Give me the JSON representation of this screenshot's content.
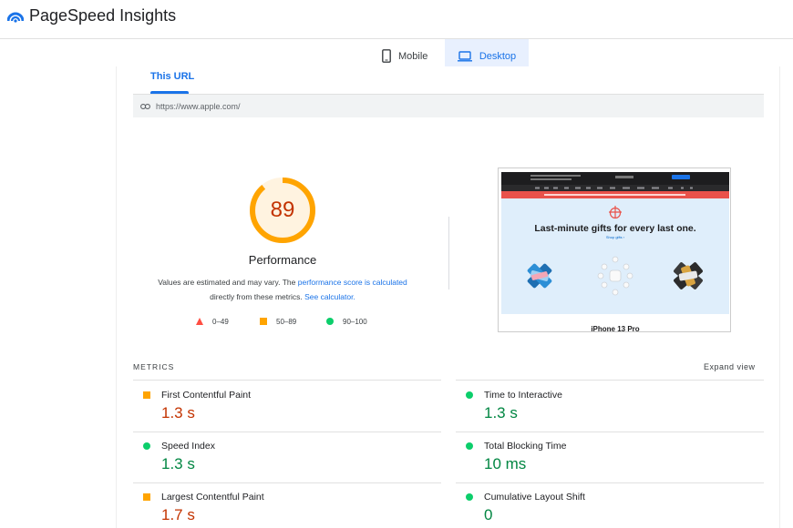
{
  "app": {
    "title": "PageSpeed Insights"
  },
  "devices": {
    "mobile": "Mobile",
    "desktop": "Desktop",
    "active": "desktop"
  },
  "url_tab": {
    "label": "This URL"
  },
  "url": "https://www.apple.com/",
  "score": {
    "value": "89",
    "value_fraction": 0.89,
    "label": "Performance",
    "note_prefix": "Values are estimated and may vary. The ",
    "note_link1": "performance score is calculated",
    "note_middle": "directly from these metrics. ",
    "note_link2": "See calculator.",
    "color": "#ffa400"
  },
  "legend": [
    {
      "range": "0–49",
      "shape": "triangle",
      "color": "#ff4e42"
    },
    {
      "range": "50–89",
      "shape": "square",
      "color": "#ffa400"
    },
    {
      "range": "90–100",
      "shape": "circle",
      "color": "#0cce6b"
    }
  ],
  "screenshot": {
    "headline": "Last-minute gifts for every last one.",
    "link": "Shop gifts ›",
    "product": "iPhone 13 Pro"
  },
  "metrics": {
    "section_label": "METRICS",
    "expand_label": "Expand view",
    "items": [
      {
        "name": "First Contentful Paint",
        "value": "1.3 s",
        "status": "average"
      },
      {
        "name": "Time to Interactive",
        "value": "1.3 s",
        "status": "pass"
      },
      {
        "name": "Speed Index",
        "value": "1.3 s",
        "status": "pass"
      },
      {
        "name": "Total Blocking Time",
        "value": "10 ms",
        "status": "pass"
      },
      {
        "name": "Largest Contentful Paint",
        "value": "1.7 s",
        "status": "average"
      },
      {
        "name": "Cumulative Layout Shift",
        "value": "0",
        "status": "pass"
      }
    ]
  },
  "colors": {
    "accent": "#1a73e8",
    "average_text": "#c33300",
    "pass_text": "#018642"
  }
}
